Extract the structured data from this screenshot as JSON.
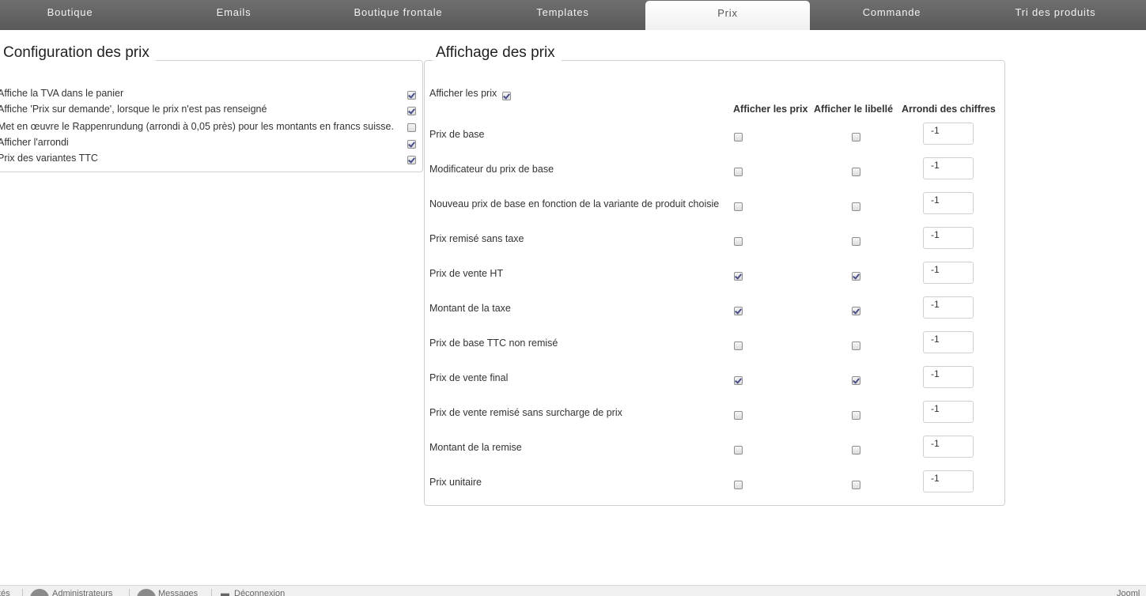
{
  "tabs": [
    {
      "label": "Boutique",
      "active": false
    },
    {
      "label": "Emails",
      "active": false
    },
    {
      "label": "Boutique frontale",
      "active": false
    },
    {
      "label": "Templates",
      "active": false
    },
    {
      "label": "Prix",
      "active": true
    },
    {
      "label": "Commande",
      "active": false
    },
    {
      "label": "Tri des produits",
      "active": false
    }
  ],
  "config": {
    "title": "Configuration des prix",
    "items": [
      {
        "label": "Affiche la TVA dans le panier",
        "checked": true
      },
      {
        "label": "Affiche 'Prix sur demande', lorsque le prix n'est pas renseigné",
        "checked": true
      },
      {
        "label": "Met en œuvre le Rappenrundung (arrondi à 0,05 près) pour les montants en francs suisse.",
        "checked": false
      },
      {
        "label": "Afficher l'arrondi",
        "checked": true
      },
      {
        "label": "Prix des variantes TTC",
        "checked": true
      }
    ]
  },
  "affichage": {
    "title": "Affichage des prix",
    "show_prices_label": "Afficher les prix",
    "show_prices_checked": true,
    "columns": [
      "Afficher les prix",
      "Afficher le libellé",
      "Arrondi des chiffres"
    ],
    "rows": [
      {
        "label": "Prix de base",
        "show": false,
        "label_show": false,
        "rounding": "-1"
      },
      {
        "label": "Modificateur du prix de base",
        "show": false,
        "label_show": false,
        "rounding": "-1"
      },
      {
        "label": "Nouveau prix de base en fonction de la variante de produit choisie",
        "show": false,
        "label_show": false,
        "rounding": "-1"
      },
      {
        "label": "Prix remisé sans taxe",
        "show": false,
        "label_show": false,
        "rounding": "-1"
      },
      {
        "label": "Prix de vente HT",
        "show": true,
        "label_show": true,
        "rounding": "-1"
      },
      {
        "label": "Montant de la taxe",
        "show": true,
        "label_show": true,
        "rounding": "-1"
      },
      {
        "label": "Prix de base TTC non remisé",
        "show": false,
        "label_show": false,
        "rounding": "-1"
      },
      {
        "label": "Prix de vente final",
        "show": true,
        "label_show": true,
        "rounding": "-1"
      },
      {
        "label": "Prix de vente remisé sans surcharge de prix",
        "show": false,
        "label_show": false,
        "rounding": "-1"
      },
      {
        "label": "Montant de la remise",
        "show": false,
        "label_show": false,
        "rounding": "-1"
      },
      {
        "label": "Prix unitaire",
        "show": false,
        "label_show": false,
        "rounding": "-1"
      }
    ]
  },
  "footer": {
    "left_fragment": "tés",
    "admins_label": "Administrateurs",
    "messages_label": "Messages",
    "logout_label": "Déconnexion",
    "right_fragment": "Jooml"
  }
}
